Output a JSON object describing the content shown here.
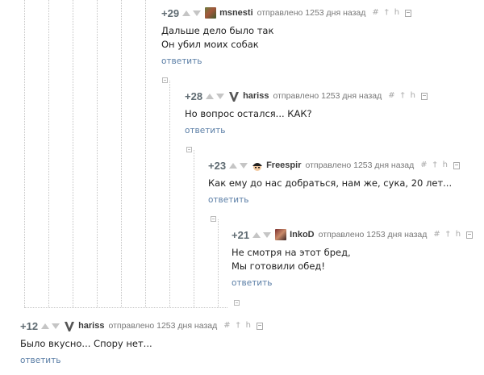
{
  "sent_label": "отправлено 1253 дня назад",
  "reply_label": "ответить",
  "tools": {
    "link": "#",
    "parent": "†",
    "reply_to": "h"
  },
  "comments": [
    {
      "rating": "+29",
      "username": "msnesti",
      "lines": [
        "Дальше дело было так",
        "Он убил моих собак"
      ]
    },
    {
      "rating": "+28",
      "username": "hariss",
      "lines": [
        "Но вопрос остался... КАК?"
      ]
    },
    {
      "rating": "+23",
      "username": "Freespir",
      "lines": [
        "Как ему до нас добраться, нам же, сука, 20 лет..."
      ]
    },
    {
      "rating": "+21",
      "username": "InkoD",
      "lines": [
        "Не смотря на этот бред,",
        "Мы готовили обед!"
      ]
    },
    {
      "rating": "+12",
      "username": "hariss",
      "lines": [
        "Было вкусно... Спору нет..."
      ]
    }
  ],
  "colors": {
    "link": "#5a7ea6",
    "rating": "#5f6b72",
    "thread_line": "#c4c4c4"
  }
}
